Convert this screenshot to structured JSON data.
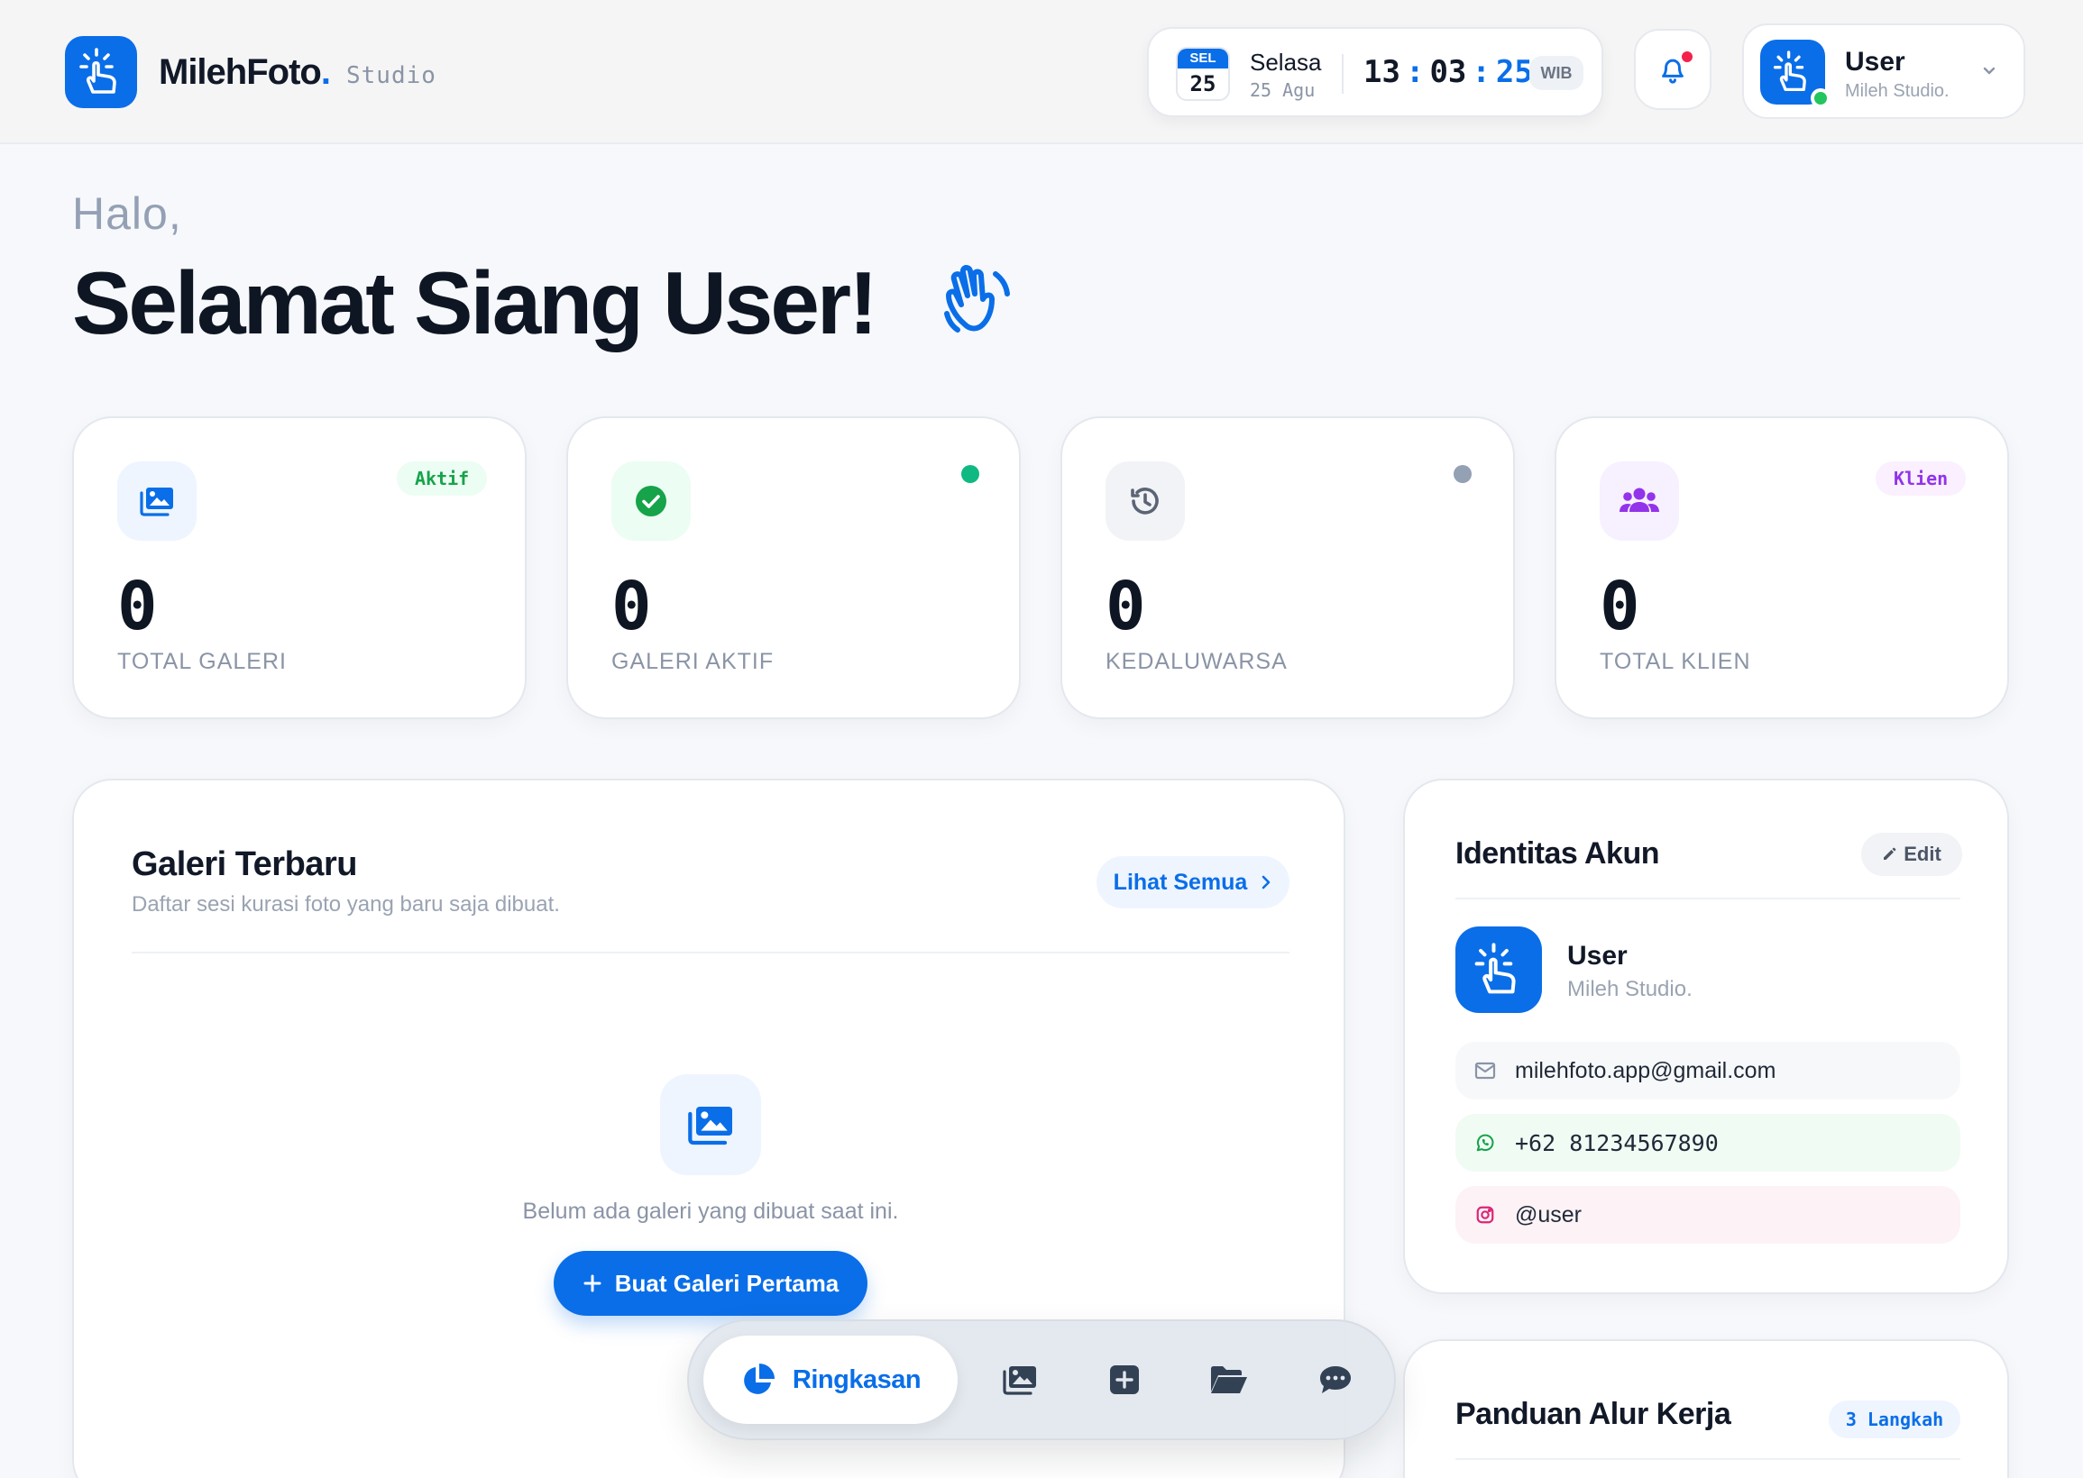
{
  "header": {
    "brand_name": "MilehFoto",
    "brand_dot": ".",
    "brand_sub": "Studio",
    "calendar_abbr": "SEL",
    "calendar_day": "25",
    "day_name": "Selasa",
    "day_date": "25 Agu",
    "clock_h": "13",
    "clock_m": "03",
    "clock_s": "25",
    "clock_sep": ":",
    "timezone": "WIB",
    "user_name": "User",
    "user_sub": "Mileh Studio."
  },
  "greeting": {
    "small": "Halo,",
    "big": "Selamat Siang User!"
  },
  "stats": [
    {
      "value": "0",
      "label": "TOTAL GALERI",
      "badge": "Aktif"
    },
    {
      "value": "0",
      "label": "GALERI AKTIF"
    },
    {
      "value": "0",
      "label": "KEDALUWARSA"
    },
    {
      "value": "0",
      "label": "TOTAL KLIEN",
      "badge": "Klien"
    }
  ],
  "galeri": {
    "title": "Galeri Terbaru",
    "subtitle": "Daftar sesi kurasi foto yang baru saja dibuat.",
    "see_all": "Lihat Semua",
    "empty_text": "Belum ada galeri yang dibuat saat ini.",
    "create_button": "Buat Galeri Pertama"
  },
  "identitas": {
    "title": "Identitas Akun",
    "edit": "Edit",
    "name": "User",
    "sub": "Mileh Studio.",
    "email": "milehfoto.app@gmail.com",
    "phone": "+62 81234567890",
    "instagram": "@user"
  },
  "panduan": {
    "title": "Panduan Alur Kerja",
    "badge": "3 Langkah"
  },
  "nav": {
    "active_label": "Ringkasan"
  },
  "colors": {
    "accent": "#0a6ee8",
    "green": "#16a34a",
    "gray": "#64748b",
    "purple": "#9333ea",
    "online": "#22c55e",
    "notification": "#f4224a"
  }
}
